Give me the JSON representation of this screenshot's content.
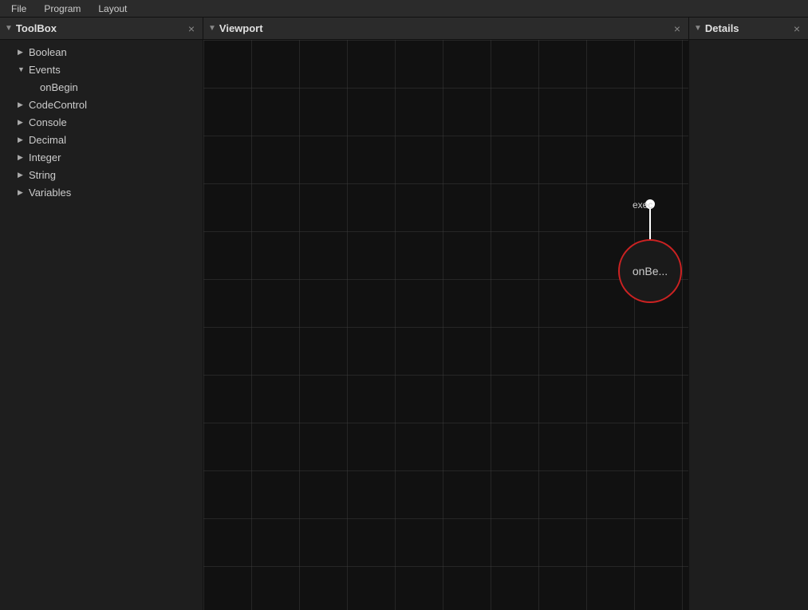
{
  "menubar": {
    "items": [
      "File",
      "Program",
      "Layout"
    ]
  },
  "toolbox": {
    "title": "ToolBox",
    "close_icon": "×",
    "arrow_icon": "▼",
    "tree": [
      {
        "id": "boolean",
        "label": "Boolean",
        "depth": 1,
        "arrow": "▶",
        "expanded": false
      },
      {
        "id": "events",
        "label": "Events",
        "depth": 1,
        "arrow": "▼",
        "expanded": true
      },
      {
        "id": "onbegin",
        "label": "onBegin",
        "depth": 2,
        "arrow": "",
        "expanded": false
      },
      {
        "id": "codecontrol",
        "label": "CodeControl",
        "depth": 1,
        "arrow": "▶",
        "expanded": false
      },
      {
        "id": "console",
        "label": "Console",
        "depth": 1,
        "arrow": "▶",
        "expanded": false
      },
      {
        "id": "decimal",
        "label": "Decimal",
        "depth": 1,
        "arrow": "▶",
        "expanded": false
      },
      {
        "id": "integer",
        "label": "Integer",
        "depth": 1,
        "arrow": "▶",
        "expanded": false
      },
      {
        "id": "string",
        "label": "String",
        "depth": 1,
        "arrow": "▶",
        "expanded": false
      },
      {
        "id": "variables",
        "label": "Variables",
        "depth": 1,
        "arrow": "▶",
        "expanded": false
      }
    ]
  },
  "viewport": {
    "title": "Viewport",
    "close_icon": "×",
    "node": {
      "exec_label": "exec",
      "label": "onBe..."
    }
  },
  "details": {
    "title": "Details",
    "close_icon": "×"
  }
}
